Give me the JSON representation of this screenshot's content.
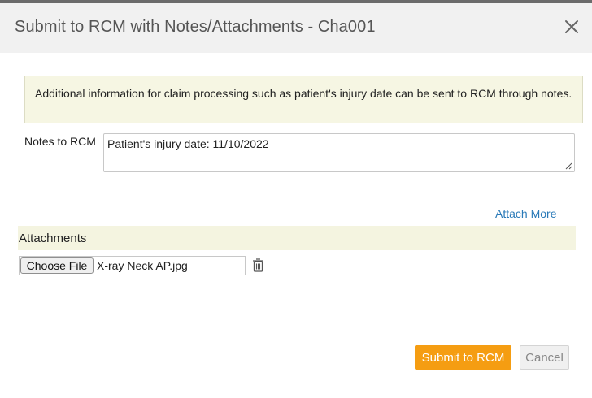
{
  "dialog": {
    "title": "Submit to RCM with Notes/Attachments - Cha001",
    "close_icon": "close-icon"
  },
  "info": {
    "text": "Additional information for claim processing such as patient's injury date can be sent to RCM through notes."
  },
  "notes": {
    "label": "Notes to RCM",
    "value": "Patient's injury date: 11/10/2022"
  },
  "attachments": {
    "attach_more_label": "Attach More",
    "section_title": "Attachments",
    "choose_file_label": "Choose File",
    "file_name": "X-ray Neck AP.jpg",
    "delete_icon": "trash-icon"
  },
  "footer": {
    "submit_label": "Submit to RCM",
    "cancel_label": "Cancel"
  },
  "colors": {
    "accent": "#f59d12",
    "link": "#2a7ab8",
    "info_bg": "#f6f6e3"
  }
}
